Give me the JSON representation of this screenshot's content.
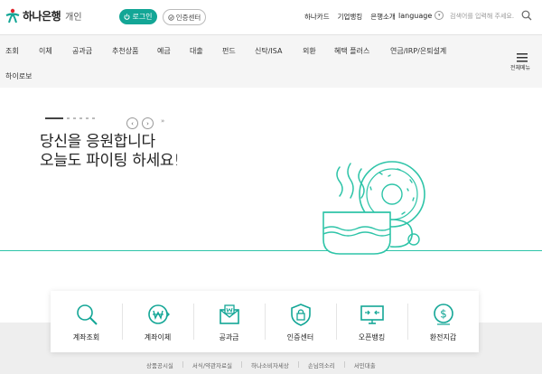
{
  "brand": {
    "name": "하나은행",
    "sub": "개인"
  },
  "header": {
    "login_label": "로그인",
    "cert_label": "인증센터",
    "links": [
      "하나카드",
      "기업뱅킹",
      "은행소개"
    ],
    "language_label": "language",
    "search_placeholder": "검색어를 입력해 주세요."
  },
  "nav": {
    "items": [
      "조회",
      "이체",
      "공과금",
      "추천상품",
      "예금",
      "대출",
      "펀드",
      "신탁/ISA",
      "외환",
      "혜택 플러스",
      "연금/IRP/은퇴설계",
      "하이로보"
    ],
    "all_menu_label": "전체메뉴"
  },
  "hero": {
    "line1": "당신을 응원합니다",
    "line2": "오늘도 파이팅 하세요!",
    "prev_label": "‹",
    "next_label": "›",
    "play_label": "»"
  },
  "quick_menu": [
    {
      "label": "계좌조회",
      "icon": "magnifier-icon"
    },
    {
      "label": "계좌이체",
      "icon": "won-transfer-icon"
    },
    {
      "label": "공과금",
      "icon": "bill-envelope-icon"
    },
    {
      "label": "인증센터",
      "icon": "lock-shield-icon"
    },
    {
      "label": "오픈뱅킹",
      "icon": "open-banking-icon"
    },
    {
      "label": "환전지갑",
      "icon": "dollar-coin-icon"
    }
  ],
  "footer": {
    "links": [
      "상품공시실",
      "서식/약관자료실",
      "하나소비자세상",
      "손님의소리",
      "서민대출"
    ]
  },
  "colors": {
    "accent": "#13a696",
    "line": "#2ec4a8"
  }
}
